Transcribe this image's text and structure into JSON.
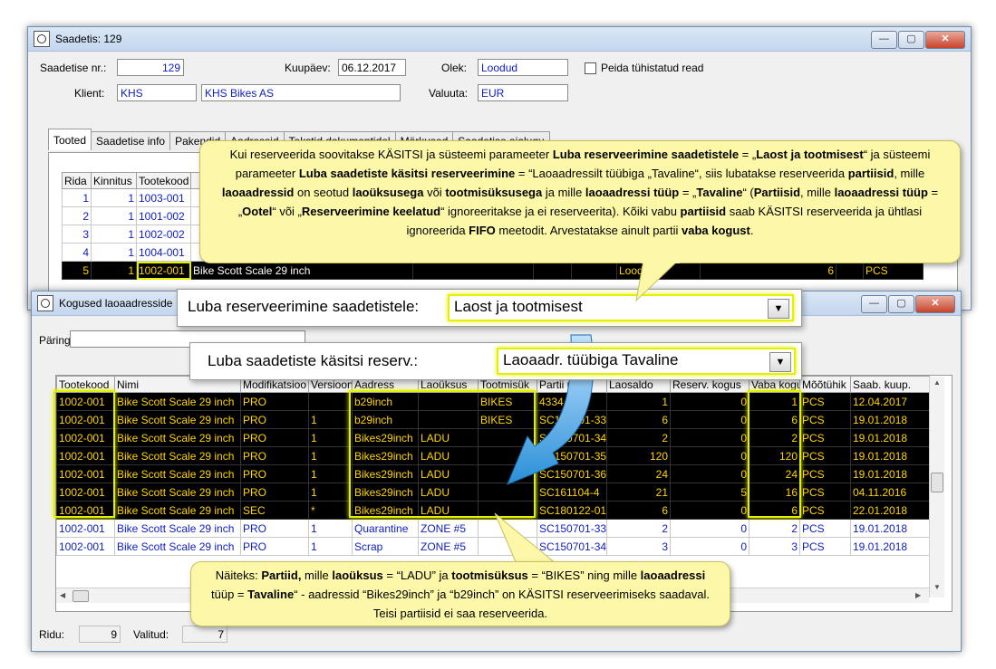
{
  "win1": {
    "title": "Saadetis: 129",
    "shipment_no_label": "Saadetise nr.:",
    "shipment_no": "129",
    "date_label": "Kuupäev:",
    "date": "06.12.2017",
    "status_label": "Olek:",
    "status": "Loodud",
    "hide_cancelled_label": "Peida tühistatud read",
    "client_label": "Klient:",
    "client_code": "KHS",
    "client_name": "KHS Bikes AS",
    "currency_label": "Valuuta:",
    "currency": "EUR",
    "tabs": [
      "Tooted",
      "Saadetise info",
      "Pakendid",
      "Aadressid",
      "Tekstid dokumentidel",
      "Märkused",
      "Saadetise ajalugu"
    ],
    "grid_headers": [
      "Rida",
      "Kinnitus",
      "Tootekood"
    ],
    "rows": [
      {
        "rida": "1",
        "kinnitus": "1",
        "code": "1003-001"
      },
      {
        "rida": "2",
        "kinnitus": "1",
        "code": "1001-002"
      },
      {
        "rida": "3",
        "kinnitus": "1",
        "code": "1002-002"
      },
      {
        "rida": "4",
        "kinnitus": "1",
        "code": "1004-001"
      },
      {
        "rida": "5",
        "kinnitus": "1",
        "code": "1002-001",
        "name": "Bike Scott Scale 29 inch",
        "status": "Loodud",
        "qty": "6",
        "unit": "PCS"
      }
    ]
  },
  "callout_top": {
    "p1": "Kui reserveerida soovitakse KÄSITSI ja süsteemi parameeter ",
    "b1": "Luba reserveerimine saadetistele",
    "p2": " = „",
    "b2": "Laost ja tootmisest",
    "p3": "“ ja süsteemi parameeter ",
    "b3": "Luba saadetiste käsitsi reserveerimine",
    "p4": " = “Laoaadressilt tüübiga „Tavaline“, siis lubatakse reserveerida ",
    "b4": "partiisid",
    "p5": ", mille ",
    "b5": "laoaadressid",
    "p6": " on seotud ",
    "b6": "laoüksusega",
    "p7": " või ",
    "b7": "tootmisüksusega",
    "p8": " ja mille ",
    "b8": "laoaadressi tüüp",
    "p9": " = „",
    "b9": "Tavaline",
    "p10": "“ (",
    "b10": "Partiisid",
    "p11": ", mille ",
    "b11": "laoaadressi tüüp",
    "p12": " = „",
    "b12": "Ootel",
    "p13": "“ või „",
    "b13": "Reserveerimine keelatud",
    "p14": "“ ignoreeritakse ja ei reserveerita). Kõiki vabu ",
    "b14": "partiisid",
    "p15": " saab KÄSITSI reserveerida ja ühtlasi ignoreerida ",
    "b15": "FIFO",
    "p16": " meetodit. Arvestatakse ainult partii ",
    "b16": "vaba kogust",
    "p17": "."
  },
  "combo1": {
    "label": "Luba reserveerimine saadetistele:",
    "value": "Laost ja tootmisest"
  },
  "combo2": {
    "label": "Luba saadetiste käsitsi reserv.:",
    "value": "Laoaadr. tüübiga Tavaline"
  },
  "win2": {
    "title": "Kogused laoaadresside",
    "query_label": "Päring:",
    "headers": [
      "Tootekood",
      "Nimi",
      "Modifikatsioo",
      "Versioon",
      "Aadress",
      "Laoüksus",
      "Tootmisük",
      "Partii nr.",
      "Laosaldo",
      "Reserv. kogus",
      "Vaba kogu",
      "Mõõtühik",
      "Saab. kuup."
    ],
    "rows": [
      {
        "dark": true,
        "c": [
          "1002-001",
          "Bike Scott Scale 29 inch",
          "PRO",
          "",
          "b29inch",
          "",
          "BIKES",
          "4334",
          "1",
          "0",
          "1",
          "PCS",
          "12.04.2017"
        ]
      },
      {
        "dark": true,
        "c": [
          "1002-001",
          "Bike Scott Scale 29 inch",
          "PRO",
          "1",
          "b29inch",
          "",
          "BIKES",
          "SC150701-33",
          "6",
          "0",
          "6",
          "PCS",
          "19.01.2018"
        ]
      },
      {
        "dark": true,
        "c": [
          "1002-001",
          "Bike Scott Scale 29 inch",
          "PRO",
          "1",
          "Bikes29inch",
          "LADU",
          "",
          "SC150701-34",
          "2",
          "0",
          "2",
          "PCS",
          "19.01.2018"
        ]
      },
      {
        "dark": true,
        "c": [
          "1002-001",
          "Bike Scott Scale 29 inch",
          "PRO",
          "1",
          "Bikes29inch",
          "LADU",
          "",
          "SC150701-35",
          "120",
          "0",
          "120",
          "PCS",
          "19.01.2018"
        ]
      },
      {
        "dark": true,
        "c": [
          "1002-001",
          "Bike Scott Scale 29 inch",
          "PRO",
          "1",
          "Bikes29inch",
          "LADU",
          "",
          "SC150701-36",
          "24",
          "0",
          "24",
          "PCS",
          "19.01.2018"
        ]
      },
      {
        "dark": true,
        "c": [
          "1002-001",
          "Bike Scott Scale 29 inch",
          "PRO",
          "1",
          "Bikes29inch",
          "LADU",
          "",
          "SC161104-4",
          "21",
          "5",
          "16",
          "PCS",
          "04.11.2016"
        ]
      },
      {
        "dark": true,
        "c": [
          "1002-001",
          "Bike Scott Scale 29 inch",
          "SEC",
          "*",
          "Bikes29inch",
          "LADU",
          "",
          "SC180122-01",
          "6",
          "0",
          "6",
          "PCS",
          "22.01.2018"
        ]
      },
      {
        "dark": false,
        "c": [
          "1002-001",
          "Bike Scott Scale 29 inch",
          "PRO",
          "1",
          "Quarantine",
          "ZONE #5",
          "",
          "SC150701-33",
          "2",
          "0",
          "2",
          "PCS",
          "19.01.2018"
        ]
      },
      {
        "dark": false,
        "c": [
          "1002-001",
          "Bike Scott Scale 29 inch",
          "PRO",
          "1",
          "Scrap",
          "ZONE #5",
          "",
          "SC150701-34",
          "3",
          "0",
          "3",
          "PCS",
          "19.01.2018"
        ]
      }
    ],
    "rows_label": "Ridu:",
    "rows_count": "9",
    "selected_label": "Valitud:",
    "selected_count": "7"
  },
  "callout_bottom": {
    "p1": "Näiteks: ",
    "b1": "Partiid,",
    "p2": " mille ",
    "b2": "laoüksus",
    "p3": " = “LADU” ja ",
    "b3": "tootmisüksus",
    "p4": " = “BIKES” ning mille ",
    "b4": "laoaadressi",
    "p5": " tüüp = ",
    "b5": "Tavaline",
    "p6": "“ - aadressid “Bikes29inch” ja “b29inch” on KÄSITSI reserveerimiseks saadaval. Teisi partiisid ei saa reserveerida."
  },
  "colors": {
    "accent_highlight": "#e5f000",
    "callout_bg": "#fdf7a8",
    "link_blue": "#1020c0",
    "arrow_blue": "#2a8fd8"
  }
}
